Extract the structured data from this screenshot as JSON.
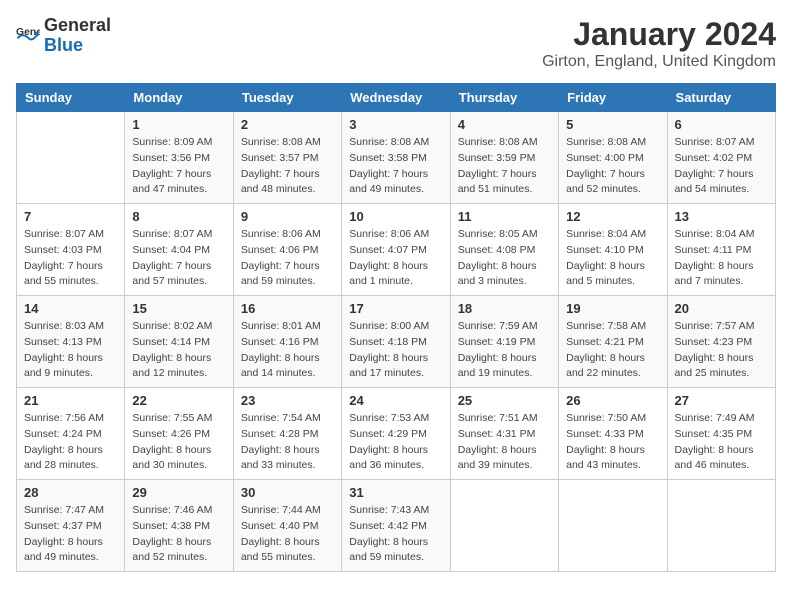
{
  "header": {
    "logo_general": "General",
    "logo_blue": "Blue",
    "month_title": "January 2024",
    "location": "Girton, England, United Kingdom"
  },
  "days_of_week": [
    "Sunday",
    "Monday",
    "Tuesday",
    "Wednesday",
    "Thursday",
    "Friday",
    "Saturday"
  ],
  "weeks": [
    [
      {
        "day": "",
        "sunrise": "",
        "sunset": "",
        "daylight": ""
      },
      {
        "day": "1",
        "sunrise": "Sunrise: 8:09 AM",
        "sunset": "Sunset: 3:56 PM",
        "daylight": "Daylight: 7 hours and 47 minutes."
      },
      {
        "day": "2",
        "sunrise": "Sunrise: 8:08 AM",
        "sunset": "Sunset: 3:57 PM",
        "daylight": "Daylight: 7 hours and 48 minutes."
      },
      {
        "day": "3",
        "sunrise": "Sunrise: 8:08 AM",
        "sunset": "Sunset: 3:58 PM",
        "daylight": "Daylight: 7 hours and 49 minutes."
      },
      {
        "day": "4",
        "sunrise": "Sunrise: 8:08 AM",
        "sunset": "Sunset: 3:59 PM",
        "daylight": "Daylight: 7 hours and 51 minutes."
      },
      {
        "day": "5",
        "sunrise": "Sunrise: 8:08 AM",
        "sunset": "Sunset: 4:00 PM",
        "daylight": "Daylight: 7 hours and 52 minutes."
      },
      {
        "day": "6",
        "sunrise": "Sunrise: 8:07 AM",
        "sunset": "Sunset: 4:02 PM",
        "daylight": "Daylight: 7 hours and 54 minutes."
      }
    ],
    [
      {
        "day": "7",
        "sunrise": "Sunrise: 8:07 AM",
        "sunset": "Sunset: 4:03 PM",
        "daylight": "Daylight: 7 hours and 55 minutes."
      },
      {
        "day": "8",
        "sunrise": "Sunrise: 8:07 AM",
        "sunset": "Sunset: 4:04 PM",
        "daylight": "Daylight: 7 hours and 57 minutes."
      },
      {
        "day": "9",
        "sunrise": "Sunrise: 8:06 AM",
        "sunset": "Sunset: 4:06 PM",
        "daylight": "Daylight: 7 hours and 59 minutes."
      },
      {
        "day": "10",
        "sunrise": "Sunrise: 8:06 AM",
        "sunset": "Sunset: 4:07 PM",
        "daylight": "Daylight: 8 hours and 1 minute."
      },
      {
        "day": "11",
        "sunrise": "Sunrise: 8:05 AM",
        "sunset": "Sunset: 4:08 PM",
        "daylight": "Daylight: 8 hours and 3 minutes."
      },
      {
        "day": "12",
        "sunrise": "Sunrise: 8:04 AM",
        "sunset": "Sunset: 4:10 PM",
        "daylight": "Daylight: 8 hours and 5 minutes."
      },
      {
        "day": "13",
        "sunrise": "Sunrise: 8:04 AM",
        "sunset": "Sunset: 4:11 PM",
        "daylight": "Daylight: 8 hours and 7 minutes."
      }
    ],
    [
      {
        "day": "14",
        "sunrise": "Sunrise: 8:03 AM",
        "sunset": "Sunset: 4:13 PM",
        "daylight": "Daylight: 8 hours and 9 minutes."
      },
      {
        "day": "15",
        "sunrise": "Sunrise: 8:02 AM",
        "sunset": "Sunset: 4:14 PM",
        "daylight": "Daylight: 8 hours and 12 minutes."
      },
      {
        "day": "16",
        "sunrise": "Sunrise: 8:01 AM",
        "sunset": "Sunset: 4:16 PM",
        "daylight": "Daylight: 8 hours and 14 minutes."
      },
      {
        "day": "17",
        "sunrise": "Sunrise: 8:00 AM",
        "sunset": "Sunset: 4:18 PM",
        "daylight": "Daylight: 8 hours and 17 minutes."
      },
      {
        "day": "18",
        "sunrise": "Sunrise: 7:59 AM",
        "sunset": "Sunset: 4:19 PM",
        "daylight": "Daylight: 8 hours and 19 minutes."
      },
      {
        "day": "19",
        "sunrise": "Sunrise: 7:58 AM",
        "sunset": "Sunset: 4:21 PM",
        "daylight": "Daylight: 8 hours and 22 minutes."
      },
      {
        "day": "20",
        "sunrise": "Sunrise: 7:57 AM",
        "sunset": "Sunset: 4:23 PM",
        "daylight": "Daylight: 8 hours and 25 minutes."
      }
    ],
    [
      {
        "day": "21",
        "sunrise": "Sunrise: 7:56 AM",
        "sunset": "Sunset: 4:24 PM",
        "daylight": "Daylight: 8 hours and 28 minutes."
      },
      {
        "day": "22",
        "sunrise": "Sunrise: 7:55 AM",
        "sunset": "Sunset: 4:26 PM",
        "daylight": "Daylight: 8 hours and 30 minutes."
      },
      {
        "day": "23",
        "sunrise": "Sunrise: 7:54 AM",
        "sunset": "Sunset: 4:28 PM",
        "daylight": "Daylight: 8 hours and 33 minutes."
      },
      {
        "day": "24",
        "sunrise": "Sunrise: 7:53 AM",
        "sunset": "Sunset: 4:29 PM",
        "daylight": "Daylight: 8 hours and 36 minutes."
      },
      {
        "day": "25",
        "sunrise": "Sunrise: 7:51 AM",
        "sunset": "Sunset: 4:31 PM",
        "daylight": "Daylight: 8 hours and 39 minutes."
      },
      {
        "day": "26",
        "sunrise": "Sunrise: 7:50 AM",
        "sunset": "Sunset: 4:33 PM",
        "daylight": "Daylight: 8 hours and 43 minutes."
      },
      {
        "day": "27",
        "sunrise": "Sunrise: 7:49 AM",
        "sunset": "Sunset: 4:35 PM",
        "daylight": "Daylight: 8 hours and 46 minutes."
      }
    ],
    [
      {
        "day": "28",
        "sunrise": "Sunrise: 7:47 AM",
        "sunset": "Sunset: 4:37 PM",
        "daylight": "Daylight: 8 hours and 49 minutes."
      },
      {
        "day": "29",
        "sunrise": "Sunrise: 7:46 AM",
        "sunset": "Sunset: 4:38 PM",
        "daylight": "Daylight: 8 hours and 52 minutes."
      },
      {
        "day": "30",
        "sunrise": "Sunrise: 7:44 AM",
        "sunset": "Sunset: 4:40 PM",
        "daylight": "Daylight: 8 hours and 55 minutes."
      },
      {
        "day": "31",
        "sunrise": "Sunrise: 7:43 AM",
        "sunset": "Sunset: 4:42 PM",
        "daylight": "Daylight: 8 hours and 59 minutes."
      },
      {
        "day": "",
        "sunrise": "",
        "sunset": "",
        "daylight": ""
      },
      {
        "day": "",
        "sunrise": "",
        "sunset": "",
        "daylight": ""
      },
      {
        "day": "",
        "sunrise": "",
        "sunset": "",
        "daylight": ""
      }
    ]
  ]
}
